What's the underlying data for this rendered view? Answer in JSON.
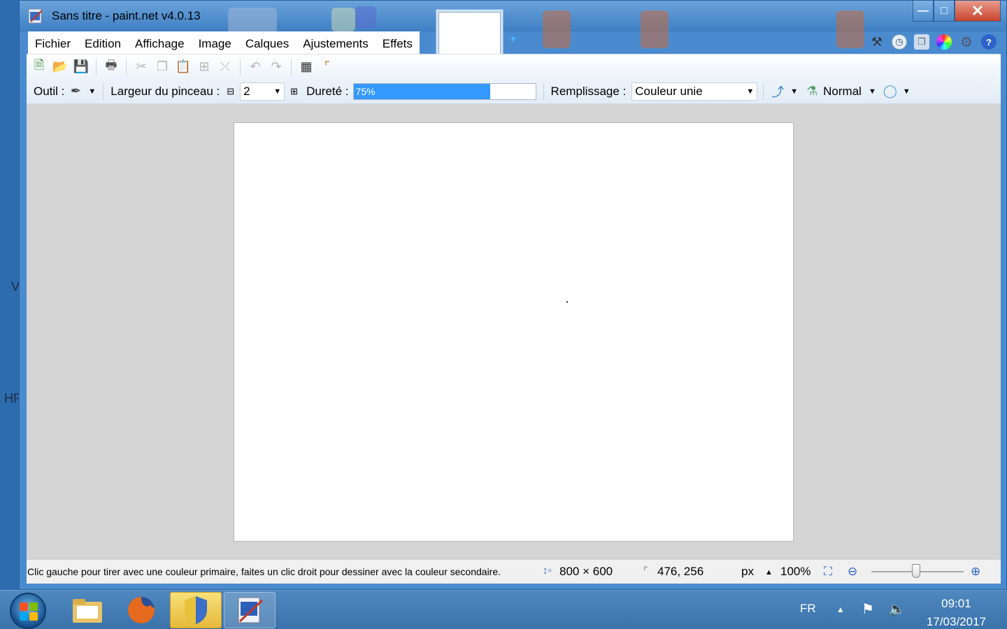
{
  "desktop": {
    "label_v": "V",
    "label_hr": "HR"
  },
  "window": {
    "title": "Sans titre - paint.net v4.0.13"
  },
  "menu": [
    "Fichier",
    "Edition",
    "Affichage",
    "Image",
    "Calques",
    "Ajustements",
    "Effets"
  ],
  "toolbar": {
    "tool_label": "Outil :",
    "brush_width_label": "Largeur du pinceau :",
    "brush_width_value": "2",
    "hardness_label": "Dureté :",
    "hardness_value": "75%",
    "hardness_fraction": 0.75,
    "fill_label": "Remplissage :",
    "fill_value": "Couleur unie",
    "blend_mode": "Normal"
  },
  "status": {
    "hint": "Clic gauche pour tirer avec une couleur primaire, faites un clic droit pour dessiner avec la couleur secondaire.",
    "image_size": "800 × 600",
    "cursor_pos": "476, 256",
    "units": "px",
    "zoom": "100%"
  },
  "taskbar": {
    "language": "FR",
    "time": "09:01",
    "date": "17/03/2017"
  },
  "colors": {
    "accent": "#3399ff",
    "canvas_bg": "#d4d4d4",
    "title_bar": "#4a8bd0"
  }
}
